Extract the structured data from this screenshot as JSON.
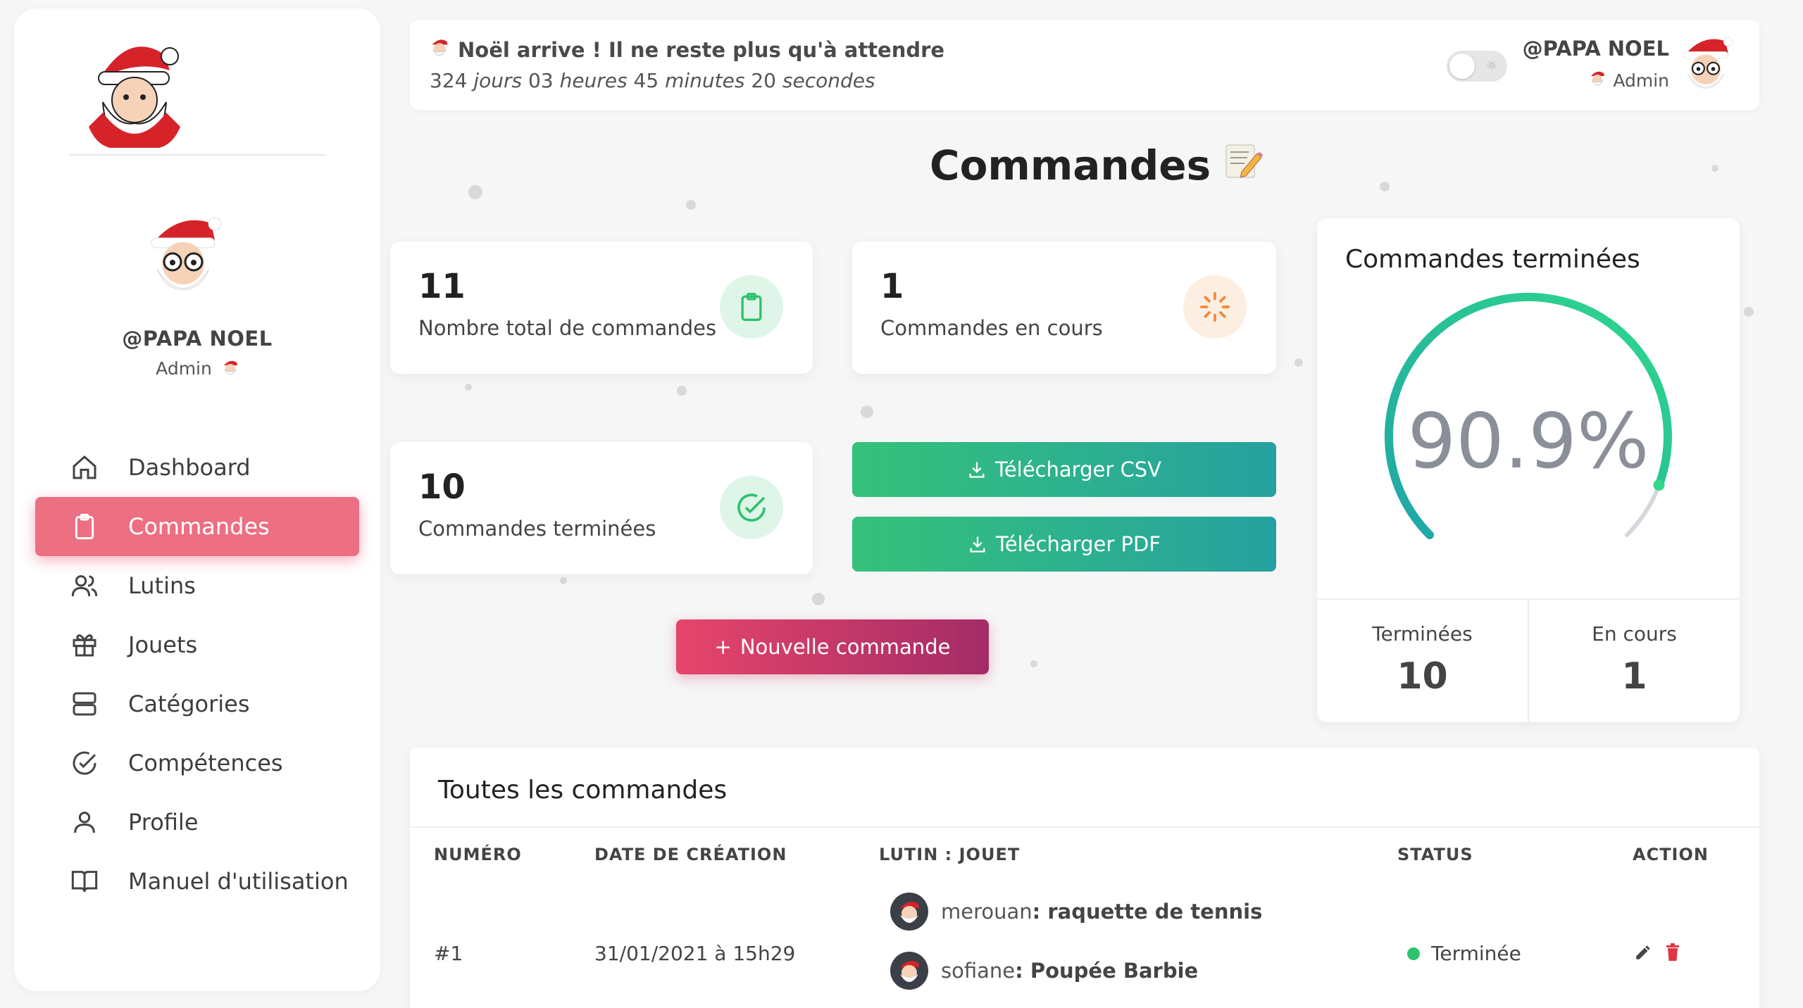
{
  "colors": {
    "accent": "#ec6f82",
    "green": "#35c27a",
    "teal": "#26a1a0",
    "red": "#e6456a",
    "status_done": "#2ec26e"
  },
  "sidebar": {
    "profile_name": "@PAPA NOEL",
    "profile_role": "Admin",
    "items": [
      {
        "label": "Dashboard",
        "icon": "home-icon"
      },
      {
        "label": "Commandes",
        "icon": "clipboard-icon",
        "active": true
      },
      {
        "label": "Lutins",
        "icon": "users-icon"
      },
      {
        "label": "Jouets",
        "icon": "gift-icon"
      },
      {
        "label": "Catégories",
        "icon": "server-icon"
      },
      {
        "label": "Compétences",
        "icon": "check-circle-icon"
      },
      {
        "label": "Profile",
        "icon": "user-icon"
      },
      {
        "label": "Manuel d'utilisation",
        "icon": "book-icon"
      }
    ]
  },
  "header": {
    "countdown_title": "Noël arrive ! Il ne reste plus qu'à attendre",
    "countdown": {
      "days": "324",
      "days_unit": "jours",
      "hours": "03",
      "hours_unit": "heures",
      "minutes": "45",
      "minutes_unit": "minutes",
      "seconds": "20",
      "seconds_unit": "secondes"
    },
    "user_name": "@PAPA NOEL",
    "user_role": "Admin"
  },
  "page_title": "Commandes",
  "stats": {
    "total": {
      "value": "11",
      "label": "Nombre total de commandes"
    },
    "in_progress": {
      "value": "1",
      "label": "Commandes en cours"
    },
    "done": {
      "value": "10",
      "label": "Commandes terminées"
    }
  },
  "buttons": {
    "csv": "Télécharger CSV",
    "pdf": "Télécharger PDF",
    "new": "Nouvelle commande",
    "new_prefix": "+"
  },
  "gauge": {
    "title": "Commandes terminées",
    "value_text": "90.9%",
    "fraction": 0.909,
    "done_label": "Terminées",
    "done_value": "10",
    "progress_label": "En cours",
    "progress_value": "1"
  },
  "table": {
    "title": "Toutes les commandes",
    "headers": [
      "NUMÉRO",
      "DATE DE CRÉATION",
      "LUTIN : JOUET",
      "STATUS",
      "ACTION"
    ],
    "rows": [
      {
        "number": "#1",
        "date": "31/01/2021 à 15h29",
        "items": [
          {
            "lutin": "merouan",
            "jouet": "raquette de tennis"
          },
          {
            "lutin": "sofiane",
            "jouet": "Poupée Barbie"
          }
        ],
        "status": "Terminée"
      }
    ]
  }
}
